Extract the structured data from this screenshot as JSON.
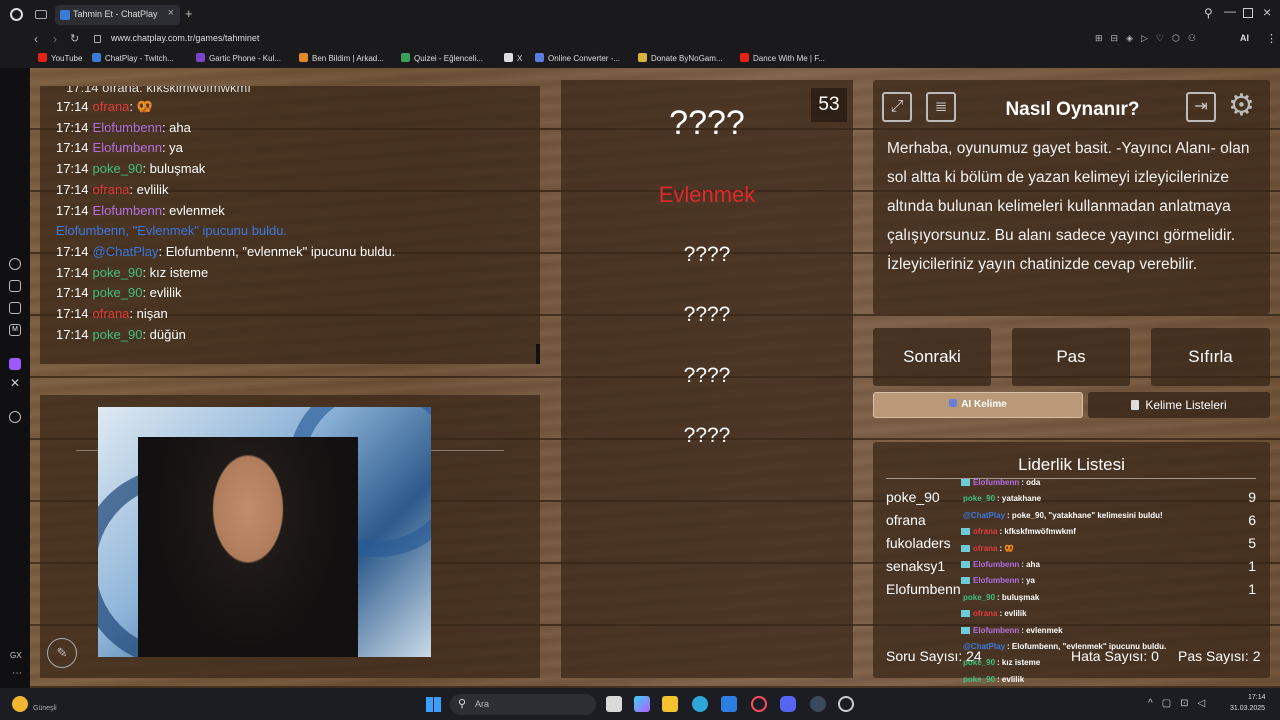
{
  "browser": {
    "tab_title": "Tahmin Et - ChatPlay",
    "address": "www.chatplay.com.tr/games/tahminet",
    "ai_label": "AI"
  },
  "bookmarks": [
    {
      "label": "YouTube",
      "color": "#e62117"
    },
    {
      "label": "ChatPlay - Twitch...",
      "color": "#3a7bd5"
    },
    {
      "label": "Gartic Phone - Kul...",
      "color": "#7a43c8"
    },
    {
      "label": "Ben Bildim | Arkad...",
      "color": "#e08a2a"
    },
    {
      "label": "Quizei - Eğlenceli...",
      "color": "#3aa05a"
    },
    {
      "label": "X",
      "color": "#dddddd"
    },
    {
      "label": "Online Converter -...",
      "color": "#5b7ce0"
    },
    {
      "label": "Donate ByNoGam...",
      "color": "#d9b23a"
    },
    {
      "label": "Dance With Me | F...",
      "color": "#e62117"
    }
  ],
  "chat": {
    "top_partial": "17:14 ofrana: kfksklmwöfmwkmf",
    "lines": [
      {
        "time": "17:14",
        "user": "ofrana",
        "color": "#e03a3a",
        "msg": "🥨"
      },
      {
        "time": "17:14",
        "user": "Elofumbenn",
        "color": "#b36ee0",
        "msg": "aha"
      },
      {
        "time": "17:14",
        "user": "Elofumbenn",
        "color": "#b36ee0",
        "msg": "ya"
      },
      {
        "time": "17:14",
        "user": "poke_90",
        "color": "#3fbf7f",
        "msg": "buluşmak"
      },
      {
        "time": "17:14",
        "user": "ofrana",
        "color": "#e03a3a",
        "msg": "evlilik"
      },
      {
        "time": "17:14",
        "user": "Elofumbenn",
        "color": "#b36ee0",
        "msg": "evlenmek"
      },
      {
        "time": "",
        "user": "Elofumbenn,",
        "color": "#3a78e0",
        "msg": "\"Evlenmek\" ipucunu buldu."
      },
      {
        "time": "17:14",
        "user": "@ChatPlay",
        "color": "#3a78e0",
        "msg": "Elofumbenn, \"evlenmek\" ipucunu buldu."
      },
      {
        "time": "17:14",
        "user": "poke_90",
        "color": "#3fbf7f",
        "msg": "kız isteme"
      },
      {
        "time": "17:14",
        "user": "poke_90",
        "color": "#3fbf7f",
        "msg": "evlilik"
      },
      {
        "time": "17:14",
        "user": "ofrana",
        "color": "#e03a3a",
        "msg": "nişan"
      },
      {
        "time": "17:14",
        "user": "poke_90",
        "color": "#3fbf7f",
        "msg": "düğün"
      }
    ]
  },
  "game": {
    "timer": "53",
    "main_word": "????",
    "hints": [
      "Evlenmek",
      "????",
      "????",
      "????",
      "????"
    ]
  },
  "howto": {
    "title": "Nasıl Oynanır?",
    "body": "Merhaba, oyunumuz gayet basit. -Yayıncı Alanı- olan sol altta ki bölüm de yazan kelimeyi izleyicilerinize altında bulunan kelimeleri kullanmadan anlatmaya çalışıyorsunuz. Bu alanı sadece yayıncı görmelidir. İzleyicileriniz yayın chatinizde cevap verebilir."
  },
  "buttons": {
    "next": "Sonraki",
    "pass": "Pas",
    "reset": "Sıfırla",
    "ai_word": "AI Kelime",
    "word_lists": "Kelime Listeleri"
  },
  "leaderboard": {
    "title": "Liderlik Listesi",
    "rows": [
      {
        "name": "poke_90",
        "score": "9"
      },
      {
        "name": "ofrana",
        "score": "6"
      },
      {
        "name": "fukoladers",
        "score": "5"
      },
      {
        "name": "senaksy1",
        "score": "1"
      },
      {
        "name": "Elofumbenn",
        "score": "1"
      }
    ]
  },
  "stats": {
    "questions": "Soru Sayısı: 24",
    "errors": "Hata Sayısı: 0",
    "passes": "Pas Sayısı: 2"
  },
  "overlay_chat": [
    {
      "user": "Elofumbenn",
      "color": "#b36ee0",
      "msg": ": oda"
    },
    {
      "user": "poke_90",
      "color": "#3fbf7f",
      "msg": ": yatakhane"
    },
    {
      "user": "@ChatPlay",
      "color": "#3a78e0",
      "msg": ": poke_90, \"yatakhane\" kelimesini buldu!"
    },
    {
      "user": "ofrana",
      "color": "#e03a3a",
      "msg": ": kfkskfmwöfmwkmf"
    },
    {
      "user": "ofrana",
      "color": "#e03a3a",
      "msg": ": 🥨"
    },
    {
      "user": "Elofumbenn",
      "color": "#b36ee0",
      "msg": ": aha"
    },
    {
      "user": "Elofumbenn",
      "color": "#b36ee0",
      "msg": ": ya"
    },
    {
      "user": "poke_90",
      "color": "#3fbf7f",
      "msg": ": buluşmak"
    },
    {
      "user": "ofrana",
      "color": "#e03a3a",
      "msg": ": evlilik"
    },
    {
      "user": "Elofumbenn",
      "color": "#b36ee0",
      "msg": ": evlenmek"
    },
    {
      "user": "@ChatPlay",
      "color": "#3a78e0",
      "msg": ": Elofumbenn, \"evlenmek\" ipucunu buldu."
    },
    {
      "user": "poke_90",
      "color": "#3fbf7f",
      "msg": ": kız isteme"
    },
    {
      "user": "poke_90",
      "color": "#3fbf7f",
      "msg": ": evlilik"
    },
    {
      "user": "ofrana",
      "color": "#e03a3a",
      "msg": ": nişan"
    },
    {
      "user": "poke_90",
      "color": "#3fbf7f",
      "msg": ": düğün"
    }
  ],
  "taskbar": {
    "search_placeholder": "Ara",
    "weather": "Güneşli",
    "time": "17:14",
    "date": "31.03.2025"
  },
  "sidebar": {
    "gx_label": "GX"
  }
}
